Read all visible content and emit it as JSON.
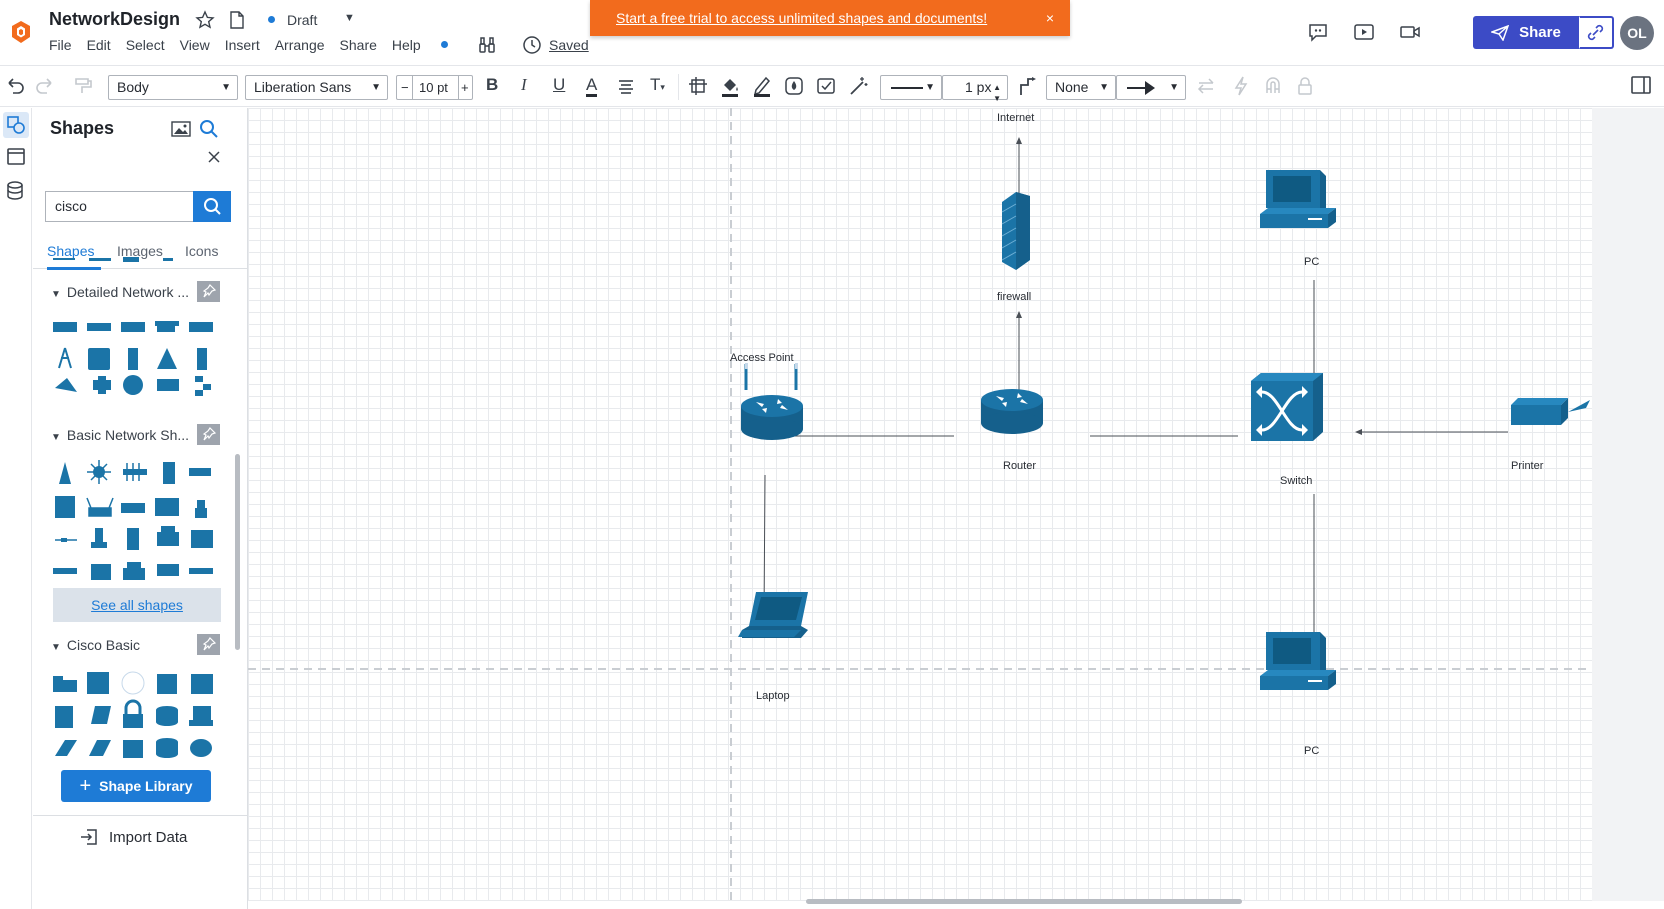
{
  "app": {
    "doc_title": "NetworkDesign",
    "draft_label": "Draft",
    "menus": [
      "File",
      "Edit",
      "Select",
      "View",
      "Insert",
      "Arrange",
      "Share",
      "Help"
    ],
    "saved_label": "Saved",
    "trial_banner": "Start a free trial to access unlimited shapes and documents!",
    "trial_close": "×",
    "share_label": "Share",
    "avatar_initials": "OL"
  },
  "toolbar": {
    "style_select": "Body",
    "font_select": "Liberation Sans",
    "font_minus": "−",
    "font_size": "10 pt",
    "font_plus": "+",
    "bold": "B",
    "italic": "I",
    "underline": "U",
    "font_color": "A",
    "text_options": "T",
    "line_width": "1 px",
    "line_start": "None"
  },
  "panel": {
    "title": "Shapes",
    "search_value": "cisco",
    "tabs": [
      "Shapes",
      "Images",
      "Icons"
    ],
    "sections": [
      "Detailed Network ...",
      "Basic Network Sh...",
      "Cisco Basic"
    ],
    "see_all": "See all shapes",
    "library_button": "Shape Library",
    "import_data": "Import Data"
  },
  "diagram": {
    "nodes": {
      "internet": "Internet",
      "firewall": "firewall",
      "access_point": "Access Point",
      "router": "Router",
      "switch": "Switch",
      "printer": "Printer",
      "laptop": "Laptop",
      "pc_top": "PC",
      "pc_bottom": "PC"
    }
  },
  "colors": {
    "accent": "#1e7bd6",
    "share": "#3c4bc6",
    "trial": "#f26b1d",
    "cisco_blue": "#1b74a7"
  }
}
